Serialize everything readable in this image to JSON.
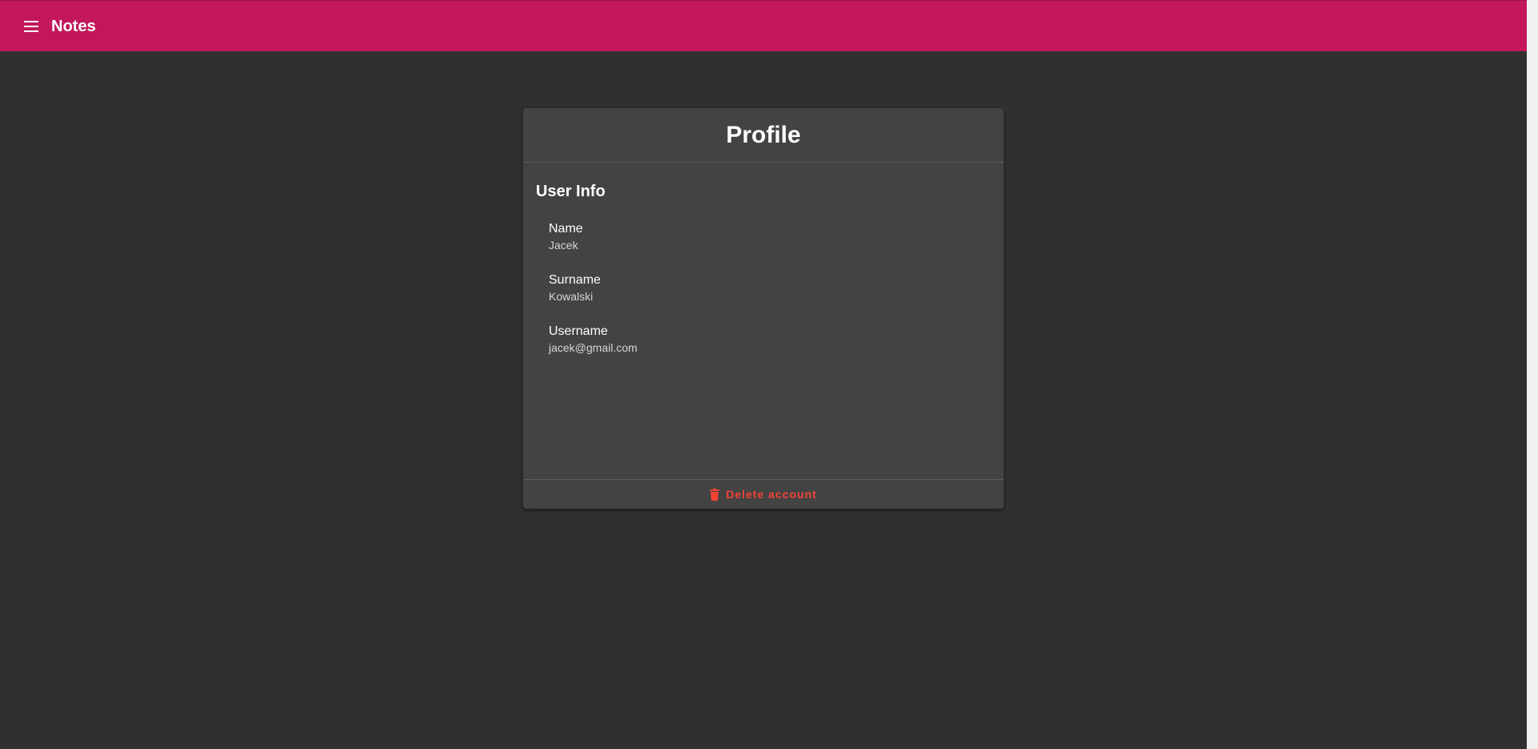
{
  "header": {
    "title": "Notes",
    "menu_icon": "menu-icon",
    "color": "#c2185b"
  },
  "card": {
    "title": "Profile",
    "section_title": "User Info",
    "fields": [
      {
        "label": "Name",
        "value": "Jacek"
      },
      {
        "label": "Surname",
        "value": "Kowalski"
      },
      {
        "label": "Username",
        "value": "jacek@gmail.com"
      }
    ],
    "delete_label": "Delete account",
    "delete_icon": "trash-icon",
    "delete_color": "#f44336"
  }
}
